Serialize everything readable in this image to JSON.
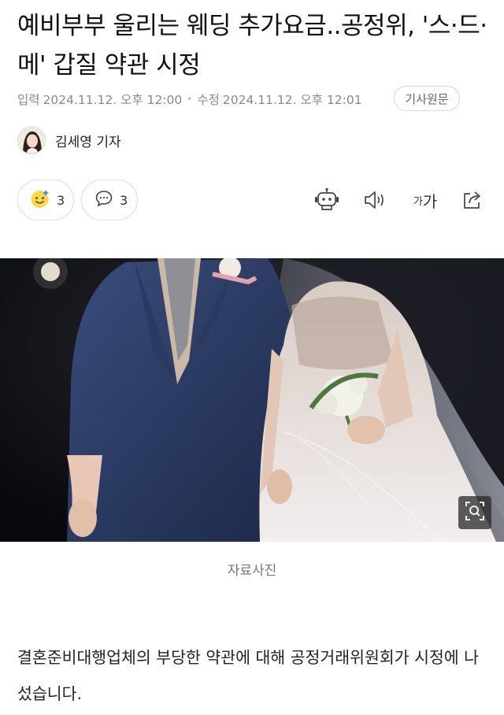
{
  "article": {
    "title": "예비부부 울리는 웨딩 추가요금..공정위, '스·드·메' 갑질 약관 시정",
    "input_label": "입력",
    "input_time": "2024.11.12. 오후 12:00",
    "modified_label": "수정",
    "modified_time": "2024.11.12. 오후 12:01",
    "original_button": "기사원문",
    "author": "김세영 기자",
    "reactions": {
      "emoji_count": "3",
      "comment_count": "3"
    },
    "tools": {
      "font_size_small": "가",
      "font_size_large": "가"
    },
    "photo_caption": "자료사진",
    "body": "결혼준비대행업체의 부당한 약관에 대해 공정거래위원회가 시정에 나섰습니다."
  },
  "icons": {
    "emoji": "smile-emoji-icon",
    "comment": "comment-bubble-icon",
    "summary": "robot-summary-icon",
    "audio": "speaker-icon",
    "font": "font-size-icon",
    "share": "share-icon",
    "zoom": "zoom-search-icon"
  }
}
